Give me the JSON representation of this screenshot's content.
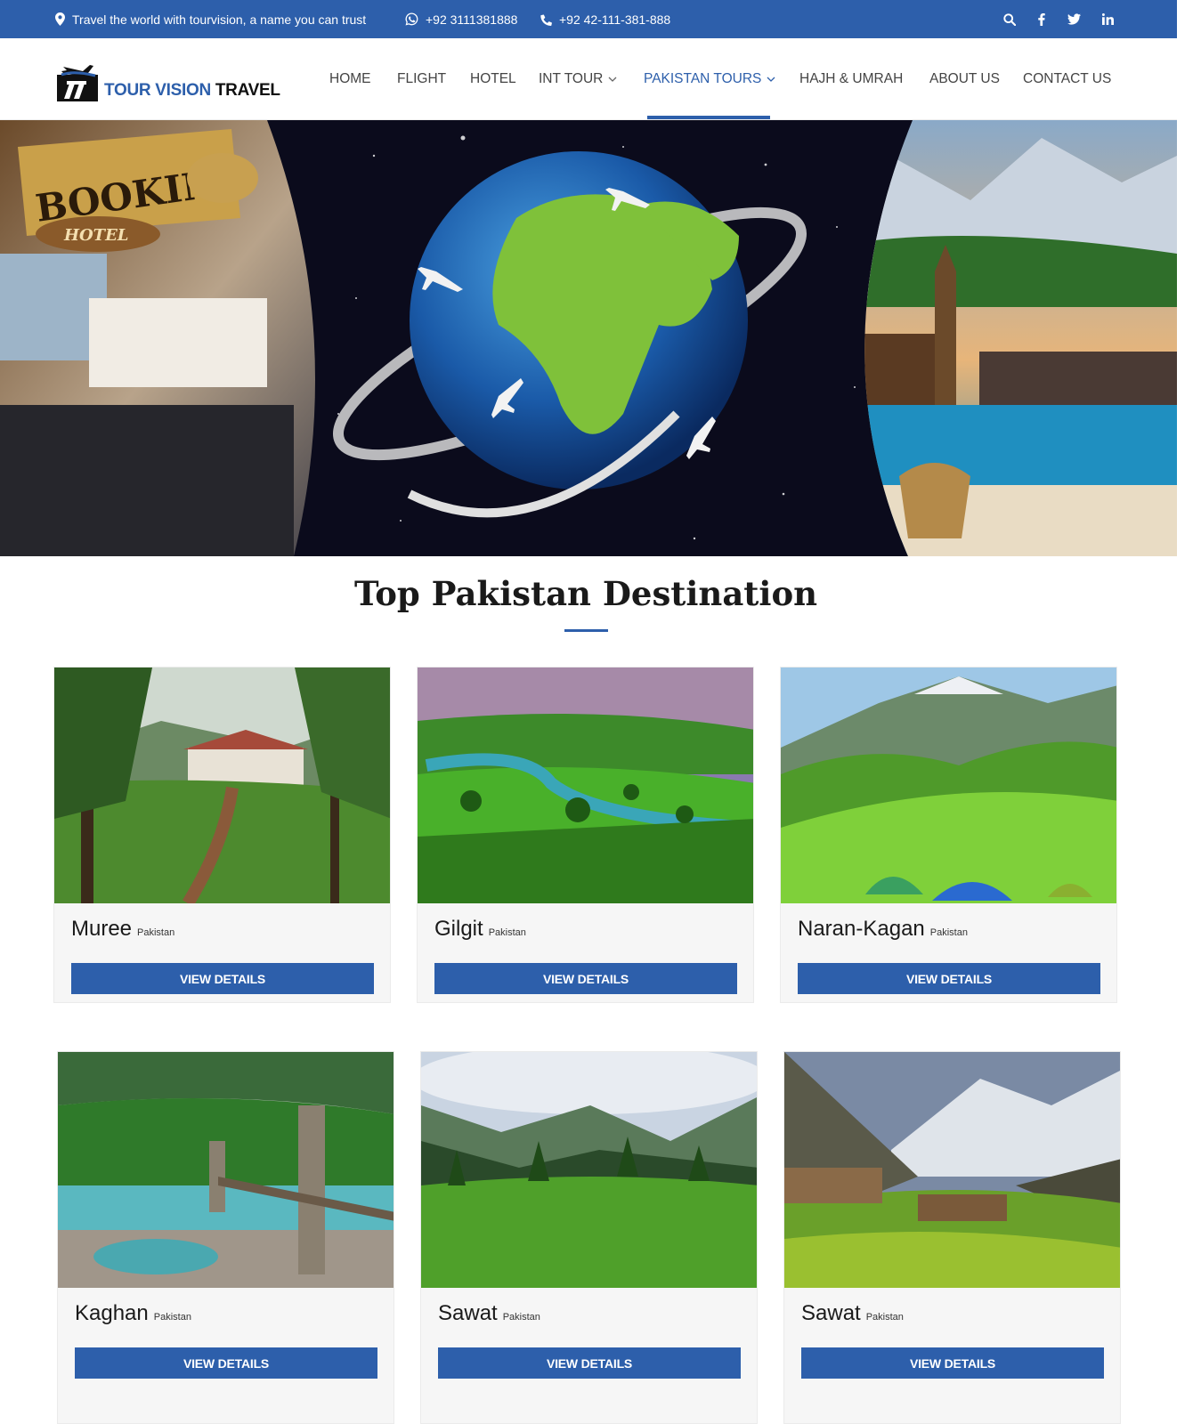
{
  "topbar": {
    "tagline": "Travel the world with tourvision, a name you can trust",
    "whatsapp": "+92 3111381888",
    "phone": "+92 42-111-381-888"
  },
  "logo": {
    "part1": "TOUR VISION",
    "part2": "TRAVEL"
  },
  "nav": {
    "home": "HOME",
    "flight": "FLIGHT",
    "hotel": "HOTEL",
    "int_tour": "INT TOUR",
    "pakistan_tours": "PAKISTAN TOURS",
    "hajj": "HAJH & UMRAH",
    "about": "ABOUT US",
    "contact": "CONTACT US"
  },
  "hero": {
    "booking_sign": "BOOKING",
    "hotel_sign": "HOTEL"
  },
  "section": {
    "title": "Top Pakistan Destination"
  },
  "destinations": [
    {
      "name": "Muree",
      "country": "Pakistan",
      "button": "VIEW DETAILS"
    },
    {
      "name": "Gilgit",
      "country": "Pakistan",
      "button": "VIEW DETAILS"
    },
    {
      "name": "Naran-Kagan",
      "country": "Pakistan",
      "button": "VIEW DETAILS"
    },
    {
      "name": "Kaghan",
      "country": "Pakistan",
      "button": "VIEW DETAILS"
    },
    {
      "name": "Sawat",
      "country": "Pakistan",
      "button": "VIEW DETAILS"
    },
    {
      "name": "Sawat",
      "country": "Pakistan",
      "button": "VIEW DETAILS"
    }
  ],
  "colors": {
    "brand": "#2d5fab",
    "card_bg": "#f6f6f6"
  }
}
